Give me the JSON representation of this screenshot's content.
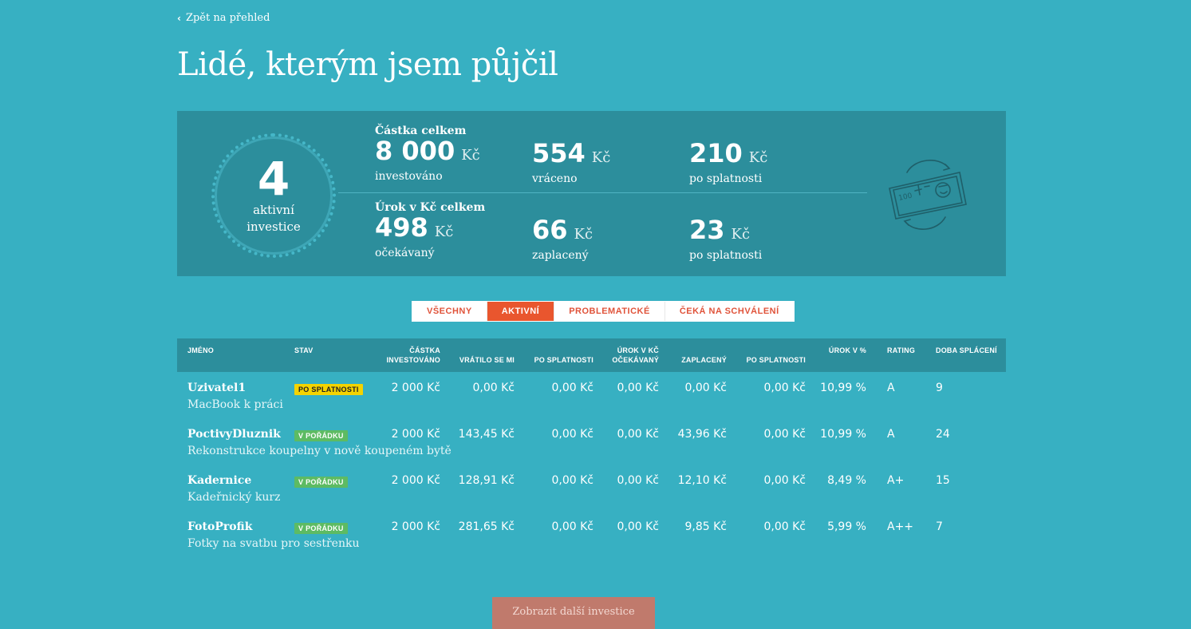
{
  "nav": {
    "back_label": "Zpět na přehled"
  },
  "page_title": "Lidé, kterým jsem půjčil",
  "summary": {
    "active_count": "4",
    "active_label_1": "aktivní",
    "active_label_2": "investice",
    "amount_heading": "Částka celkem",
    "interest_heading": "Úrok v Kč celkem",
    "unit": "Kč",
    "amount": [
      {
        "value": "8 000",
        "label": "investováno"
      },
      {
        "value": "554",
        "label": "vráceno"
      },
      {
        "value": "210",
        "label": "po splatnosti"
      }
    ],
    "interest": [
      {
        "value": "498",
        "label": "očekávaný"
      },
      {
        "value": "66",
        "label": "zaplacený"
      },
      {
        "value": "23",
        "label": "po splatnosti"
      }
    ],
    "icon": "money-exchange-icon"
  },
  "tabs": [
    {
      "label": "VŠECHNY",
      "active": false
    },
    {
      "label": "AKTIVNÍ",
      "active": true
    },
    {
      "label": "PROBLEMATICKÉ",
      "active": false
    },
    {
      "label": "ČEKÁ NA SCHVÁLENÍ",
      "active": false
    }
  ],
  "table": {
    "headers": {
      "name": "JMÉNO",
      "status": "STAV",
      "invested_1": "ČÁSTKA",
      "invested_2": "INVESTOVÁNO",
      "returned": "VRÁTILO SE MI",
      "overdue": "PO SPLATNOSTI",
      "interest_expected_1": "ÚROK V KČ",
      "interest_expected_2": "OČEKÁVANÝ",
      "interest_paid": "ZAPLACENÝ",
      "interest_overdue": "PO SPLATNOSTI",
      "rate": "ÚROK V %",
      "rating": "RATING",
      "term": "DOBA SPLÁCENÍ"
    },
    "rows": [
      {
        "name": "Uzivatel1",
        "desc": "MacBook k práci",
        "status": "PO SPLATNOSTI",
        "status_type": "warn",
        "invested": "2 000 Kč",
        "returned": "0,00 Kč",
        "overdue": "0,00 Kč",
        "interest_expected": "0,00 Kč",
        "interest_paid": "0,00 Kč",
        "interest_overdue": "0,00 Kč",
        "rate": "10,99 %",
        "rating": "A",
        "term": "9"
      },
      {
        "name": "PoctivyDluznik",
        "desc": "Rekonstrukce koupelny v nově koupeném bytě",
        "status": "V POŘÁDKU",
        "status_type": "ok",
        "invested": "2 000 Kč",
        "returned": "143,45 Kč",
        "overdue": "0,00 Kč",
        "interest_expected": "0,00 Kč",
        "interest_paid": "43,96 Kč",
        "interest_overdue": "0,00 Kč",
        "rate": "10,99 %",
        "rating": "A",
        "term": "24"
      },
      {
        "name": "Kadernice",
        "desc": "Kadeřnický kurz",
        "status": "V POŘÁDKU",
        "status_type": "ok",
        "invested": "2 000 Kč",
        "returned": "128,91 Kč",
        "overdue": "0,00 Kč",
        "interest_expected": "0,00 Kč",
        "interest_paid": "12,10 Kč",
        "interest_overdue": "0,00 Kč",
        "rate": "8,49 %",
        "rating": "A+",
        "term": "15"
      },
      {
        "name": "FotoProfik",
        "desc": "Fotky na svatbu pro sestřenku",
        "status": "V POŘÁDKU",
        "status_type": "ok",
        "invested": "2 000 Kč",
        "returned": "281,65 Kč",
        "overdue": "0,00 Kč",
        "interest_expected": "0,00 Kč",
        "interest_paid": "9,85 Kč",
        "interest_overdue": "0,00 Kč",
        "rate": "5,99 %",
        "rating": "A++",
        "term": "7"
      }
    ]
  },
  "more_button": "Zobrazit další investice",
  "colors": {
    "background": "#37b0c2",
    "panel": "#2c8e9c",
    "accent": "#e9562e",
    "warn": "#f4d300",
    "ok": "#5dbb63"
  }
}
